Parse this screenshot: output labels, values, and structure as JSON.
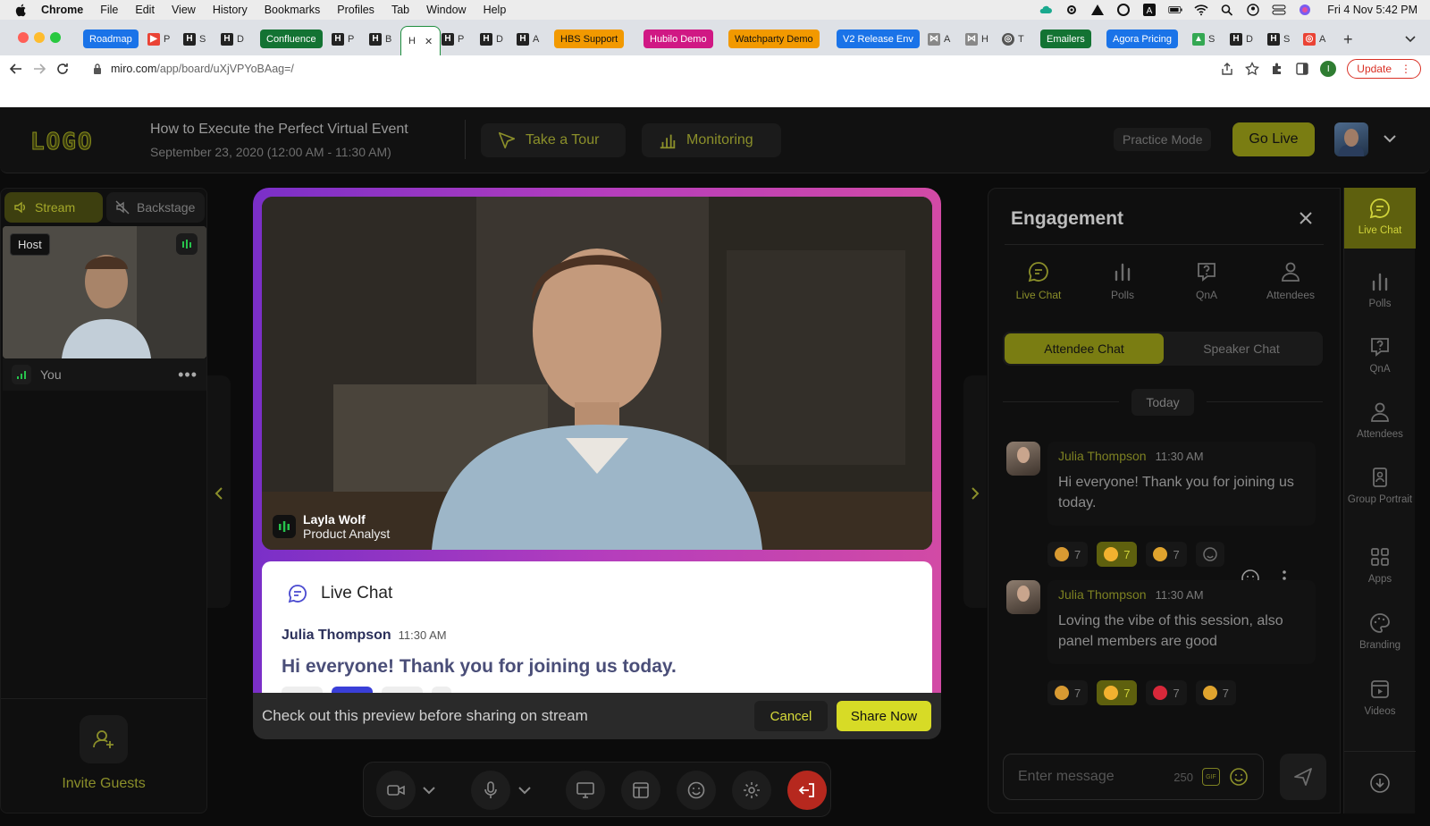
{
  "mac_menubar": {
    "app": "Chrome",
    "items": [
      "File",
      "Edit",
      "View",
      "History",
      "Bookmarks",
      "Profiles",
      "Tab",
      "Window",
      "Help"
    ],
    "clock": "Fri 4 Nov  5:42 PM"
  },
  "browser": {
    "tabs": [
      {
        "label": "Roadmap",
        "color": "#1a73e8"
      },
      {
        "label": "Confluence",
        "color": "#137333"
      },
      {
        "label": "HBS Support",
        "color": "#f29900"
      },
      {
        "label": "Hubilo Demo",
        "color": "#d01884"
      },
      {
        "label": "Watchparty Demo",
        "color": "#f29900"
      },
      {
        "label": "V2 Release Env",
        "color": "#1a73e8"
      },
      {
        "label": "Emailers",
        "color": "#137333"
      },
      {
        "label": "Agora Pricing",
        "color": "#1a73e8"
      }
    ],
    "small_tab_labels": [
      "P",
      "S",
      "D",
      "P",
      "B",
      "H",
      "P",
      "D",
      "A",
      "A",
      "H",
      "T",
      "S",
      "D",
      "S",
      "A"
    ],
    "url_domain": "miro.com",
    "url_path": "/app/board/uXjVPYoBAag=/",
    "profile_initial": "I",
    "update_label": "Update"
  },
  "header": {
    "logo": "LOGO",
    "event_title": "How to Execute the Perfect Virtual Event",
    "event_date": "September 23, 2020 (12:00 AM - 11:30 AM)",
    "tour_label": "Take a Tour",
    "monitoring_label": "Monitoring",
    "practice_label": "Practice Mode",
    "golive_label": "Go Live"
  },
  "left_panel": {
    "stream_tab": "Stream",
    "backstage_tab": "Backstage",
    "host_badge": "Host",
    "you_label": "You",
    "more_label": "•••",
    "invite_label": "Invite Guests"
  },
  "stage": {
    "speaker_name": "Layla Wolf",
    "speaker_role": "Product Analyst",
    "preview": {
      "title": "Live Chat",
      "author": "Julia Thompson",
      "time": "11:30 AM",
      "message": "Hi everyone! Thank you for joining us today."
    },
    "share_prompt": "Check out this preview before sharing on stream",
    "cancel_label": "Cancel",
    "share_label": "Share Now"
  },
  "engagement": {
    "title": "Engagement",
    "tabs": [
      "Live Chat",
      "Polls",
      "QnA",
      "Attendees"
    ],
    "attendee_chat": "Attendee Chat",
    "speaker_chat": "Speaker Chat",
    "date_divider": "Today",
    "messages": [
      {
        "author": "Julia Thompson",
        "time": "11:30 AM",
        "text": "Hi everyone! Thank you for joining us today.",
        "reactions": [
          "7",
          "7",
          "7"
        ]
      },
      {
        "author": "Julia Thompson",
        "time": "11:30 AM",
        "text": "Loving the vibe of this session, also panel members are good",
        "reactions": [
          "7",
          "7",
          "7",
          "7"
        ]
      }
    ],
    "composer_placeholder": "Enter message",
    "char_count": "250",
    "gif_label": "GIF"
  },
  "rail": {
    "items": [
      "Live Chat",
      "Polls",
      "QnA",
      "Attendees",
      "Group Portrait",
      "Apps",
      "Branding",
      "Videos"
    ]
  },
  "colors": {
    "accent": "#7a7d12",
    "accent_bright": "#d7db26",
    "stage_gradient_start": "#7a2fc8",
    "stage_gradient_end": "#d24aa5",
    "leave": "#b6281e"
  }
}
